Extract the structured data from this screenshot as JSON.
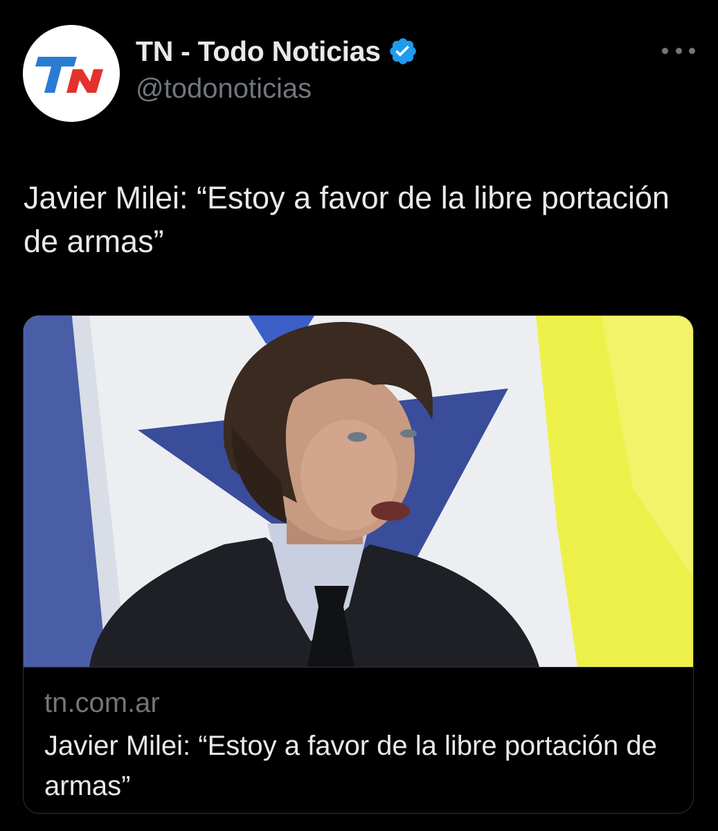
{
  "account": {
    "display_name": "TN - Todo Noticias",
    "handle": "@todonoticias",
    "verified": true,
    "avatar_logo_text": "TN"
  },
  "tweet": {
    "text": "Javier Milei: “Estoy a favor de la libre portación de armas”"
  },
  "card": {
    "domain": "tn.com.ar",
    "title": "Javier Milei: “Estoy a favor de la libre portación de armas”"
  },
  "icons": {
    "more": "more-options-icon",
    "verified": "verified-badge-icon"
  },
  "colors": {
    "background": "#000000",
    "primary_text": "#e7e9ea",
    "secondary_text": "#71767b",
    "border": "#2f3336",
    "verified_blue": "#1d9bf0",
    "logo_red": "#e4312b",
    "logo_blue": "#2a7bd4"
  }
}
